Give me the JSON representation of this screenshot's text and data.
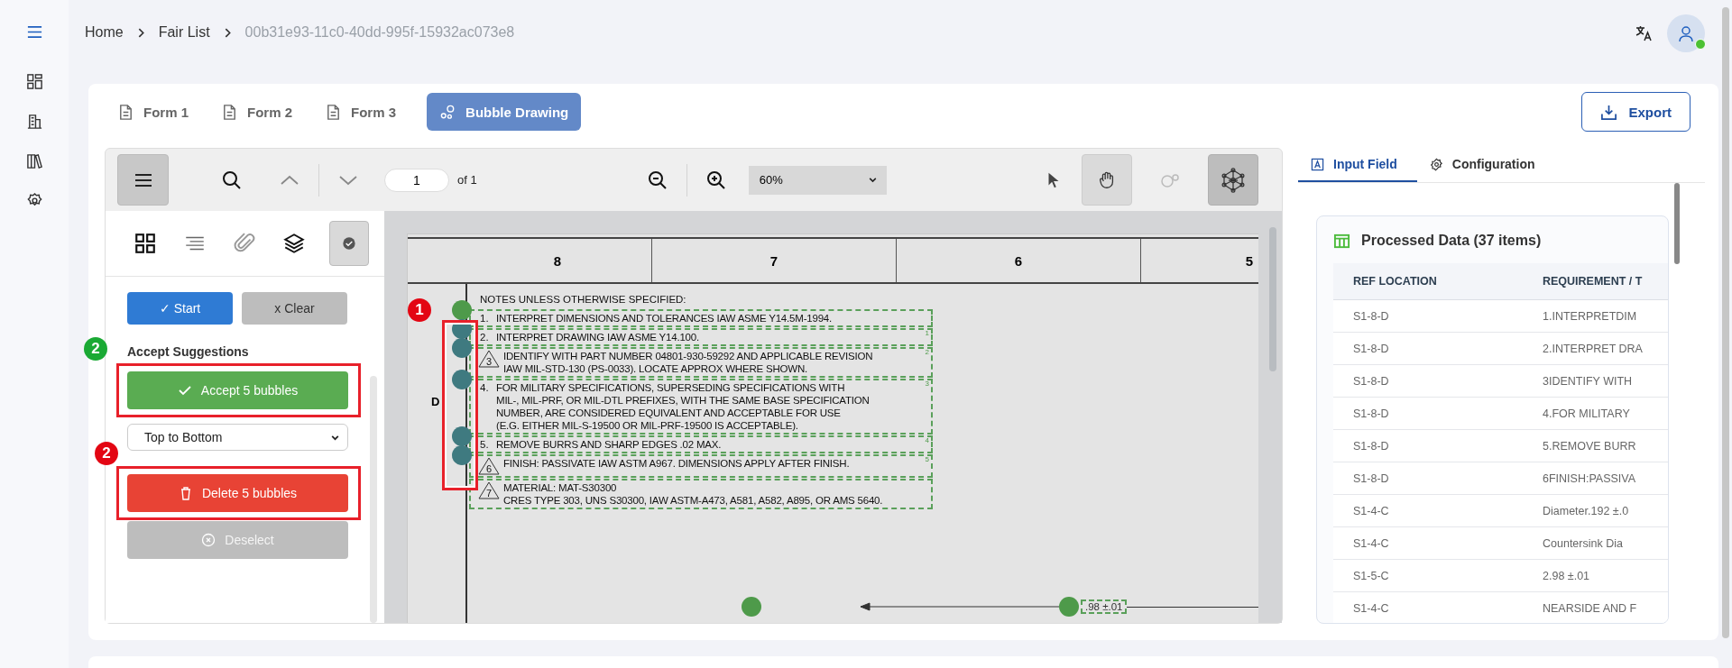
{
  "breadcrumb": [
    {
      "label": "Home",
      "current": false
    },
    {
      "label": "Fair List",
      "current": false
    },
    {
      "label": "00b31e93-11c0-40dd-995f-15932ac073e8",
      "current": true
    }
  ],
  "user": {
    "online": true
  },
  "tabs": [
    {
      "label": "Form 1",
      "kind": "form",
      "selected": false
    },
    {
      "label": "Form 2",
      "kind": "form",
      "selected": false
    },
    {
      "label": "Form 3",
      "kind": "form",
      "selected": false
    },
    {
      "label": "Bubble Drawing",
      "kind": "drawing",
      "selected": true
    }
  ],
  "export_button": "Export",
  "viewer": {
    "toolbar": {
      "sidebar_toggle": {
        "selected": true
      },
      "page_input": "1",
      "page_count": "of 1",
      "zoom": "60%",
      "tools": [
        {
          "kind": "pointer",
          "selected": false
        },
        {
          "kind": "hand",
          "selected": true
        },
        {
          "kind": "bubbles",
          "selected": false
        },
        {
          "kind": "network",
          "selected": true
        }
      ]
    },
    "panel_tabs": [
      {
        "kind": "thumbnails",
        "selected": false
      },
      {
        "kind": "outline",
        "selected": false
      },
      {
        "kind": "attachments",
        "selected": false
      },
      {
        "kind": "layers",
        "selected": false
      },
      {
        "kind": "suggestions",
        "selected": true
      }
    ],
    "start_button": "✓ Start",
    "clear_button": "x Clear",
    "section_label": "Accept Suggestions",
    "accept_button": {
      "label": "Accept 5 bubbles",
      "highlight": {
        "number": "2",
        "color": "#1aa934"
      }
    },
    "order_select": "Top to Bottom",
    "delete_button": {
      "label": "Delete 5 bubbles",
      "highlight": {
        "number": "2",
        "color": "#e30613"
      }
    },
    "deselect_button": {
      "label": "Deselect",
      "disabled": true
    },
    "drawing": {
      "zones": [
        "8",
        "7",
        "6",
        "5"
      ],
      "zone_letter": "D",
      "notes_title": "NOTES UNLESS OTHERWISE SPECIFIED:",
      "highlight": {
        "number": "1",
        "color": "#e30613"
      },
      "notes": [
        {
          "marker": "1.",
          "kind": "number",
          "bubble": {
            "color": "#4e9a4a"
          },
          "lines": [
            "INTERPRET DIMENSIONS AND TOLERANCES IAW ASME Y14.5M-1994."
          ]
        },
        {
          "marker": "2.",
          "kind": "number",
          "bubble": {
            "color": "#3f7a80"
          },
          "box_label": "1",
          "lines": [
            "INTERPRET DRAWING IAW ASME Y14.100."
          ]
        },
        {
          "marker": "3",
          "kind": "triangle",
          "bubble": {
            "color": "#3f7a80"
          },
          "box_label": "2",
          "lines": [
            "IDENTIFY WITH PART NUMBER 04801-930-59292 AND APPLICABLE REVISION",
            "IAW MIL-STD-130 (PS-0033). LOCATE APPROX WHERE SHOWN."
          ]
        },
        {
          "marker": "4.",
          "kind": "number",
          "bubble": {
            "color": "#3f7a80"
          },
          "box_label": "3",
          "lines": [
            "FOR MILITARY SPECIFICATIONS, SUPERSEDING SPECIFICATIONS WITH",
            "MIL-, MIL-PRF, OR MIL-DTL PREFIXES, WITH THE SAME BASE SPECIFICATION",
            "NUMBER, ARE CONSIDERED EQUIVALENT AND ACCEPTABLE FOR USE",
            "(E.G. EITHER MIL-S-19500 OR MIL-PRF-19500 IS ACCEPTABLE)."
          ]
        },
        {
          "marker": "5.",
          "kind": "number",
          "bubble": {
            "color": "#3f7a80"
          },
          "box_label": "4",
          "lines": [
            "REMOVE BURRS AND SHARP EDGES .02 MAX."
          ]
        },
        {
          "marker": "6",
          "kind": "triangle",
          "bubble": {
            "color": "#3f7a80"
          },
          "box_label": "5",
          "lines": [
            "FINISH: PASSIVATE IAW ASTM A967. DIMENSIONS APPLY AFTER FINISH."
          ]
        },
        {
          "marker": "7",
          "kind": "triangle",
          "lines": [
            "MATERIAL: MAT-S30300",
            "CRES TYPE 303, UNS S30300, IAW ASTM-A473, A581, A582, A895, OR AMS 5640."
          ]
        }
      ],
      "dimension": {
        "bubble": {
          "color": "#4e9a4a"
        },
        "label": ".98 ±.01"
      },
      "lone_bubble": {
        "color": "#4e9a4a"
      }
    }
  },
  "side_panel": {
    "tabs": [
      {
        "label": "Input Field",
        "kind": "input",
        "selected": true
      },
      {
        "label": "Configuration",
        "kind": "config",
        "selected": false
      }
    ],
    "card_title": "Processed Data (37 items)",
    "table": {
      "columns": [
        "REF LOCATION",
        "REQUIREMENT / T"
      ],
      "rows": [
        [
          "S1-8-D",
          "1.INTERPRETDIM"
        ],
        [
          "S1-8-D",
          "2.INTERPRET DRA"
        ],
        [
          "S1-8-D",
          "3IDENTIFY WITH"
        ],
        [
          "S1-8-D",
          "4.FOR MILITARY"
        ],
        [
          "S1-8-D",
          "5.REMOVE BURR"
        ],
        [
          "S1-8-D",
          "6FINISH:PASSIVA"
        ],
        [
          "S1-4-C",
          "Diameter.192 ±.0"
        ],
        [
          "S1-4-C",
          "Countersink Dia"
        ],
        [
          "S1-5-C",
          "2.98 ±.01"
        ],
        [
          "S1-4-C",
          "NEARSIDE AND F"
        ]
      ]
    }
  }
}
